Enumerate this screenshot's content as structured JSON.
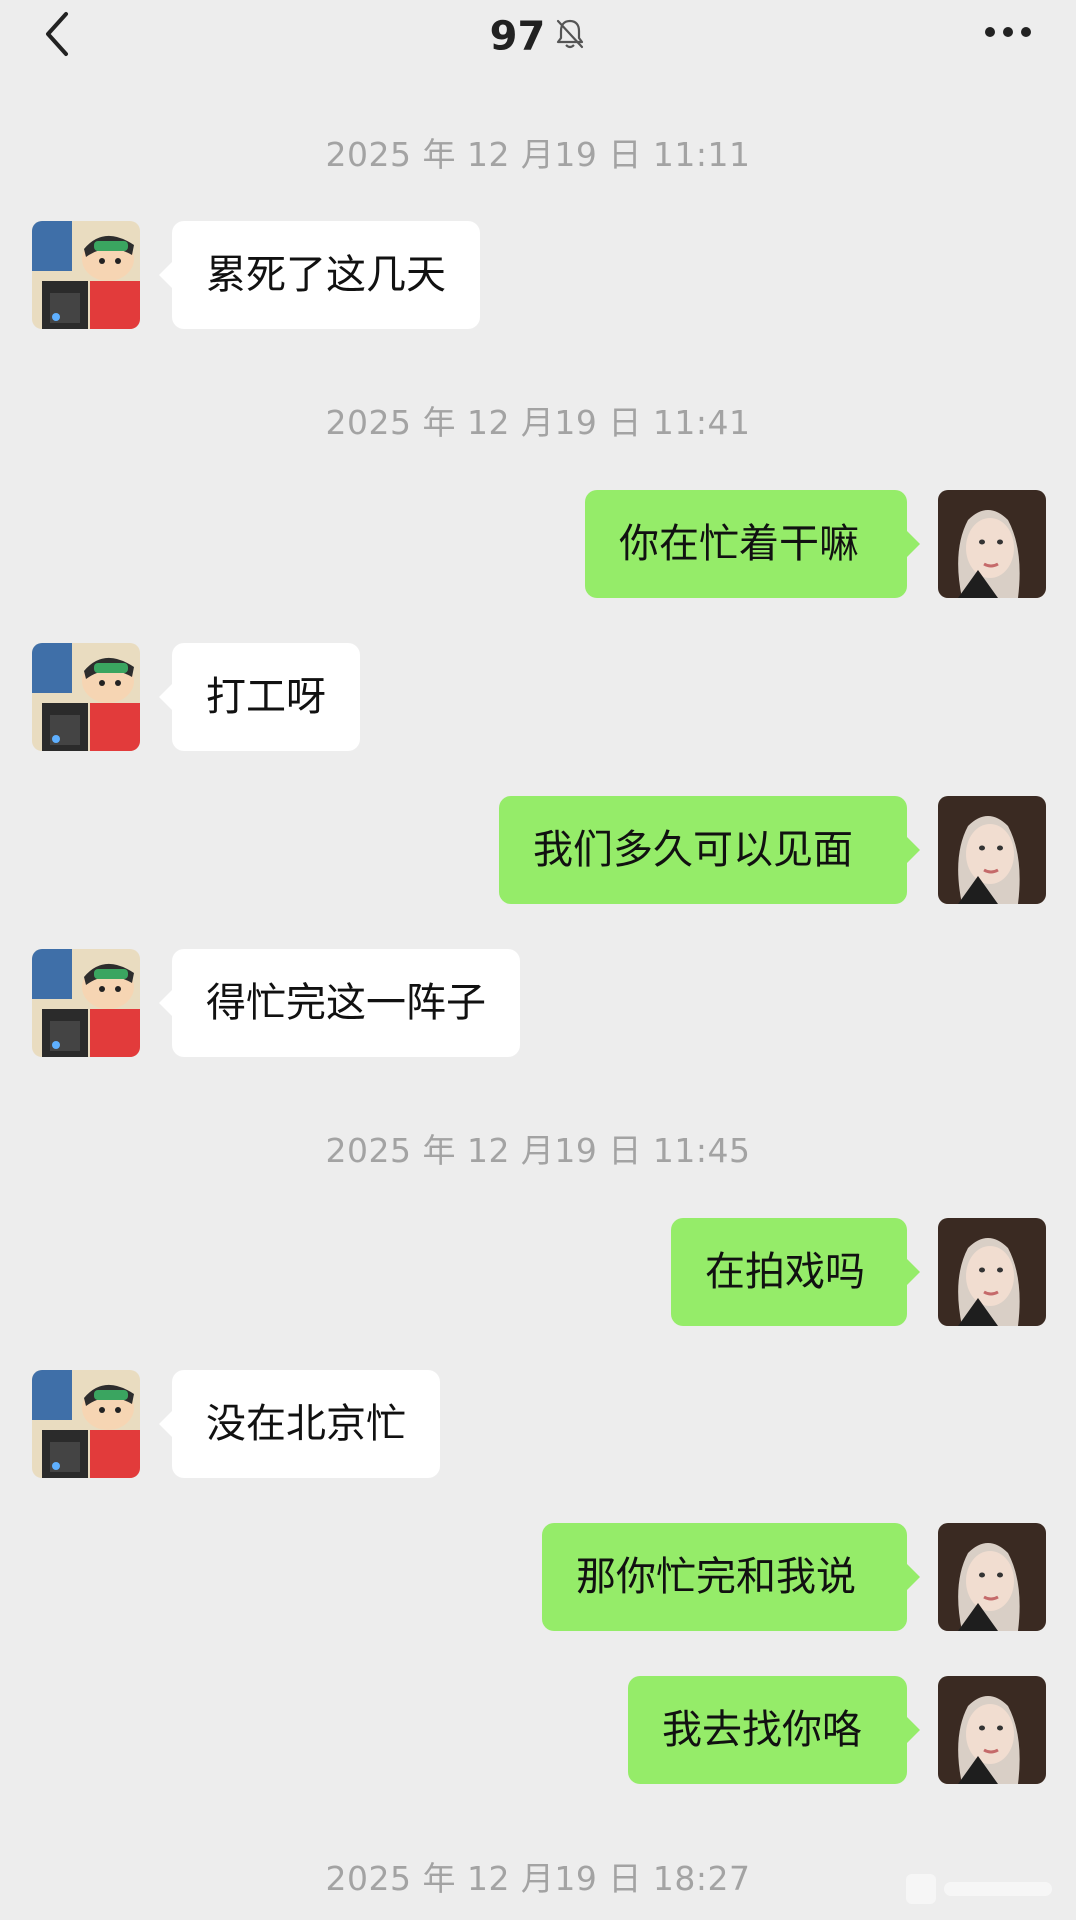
{
  "header": {
    "title": "97",
    "back_icon": "chevron-left-icon",
    "mute_icon": "bell-off-icon",
    "more_icon": "more-horizontal-icon"
  },
  "colors": {
    "background": "#ededed",
    "incoming_bubble": "#ffffff",
    "outgoing_bubble": "#95ec69",
    "timestamp_text": "#a3a3a3"
  },
  "messages": {
    "ts1": "2025 年 12 月19 日 11:11",
    "m1": "累死了这几天",
    "ts2": "2025 年 12 月19 日 11:41",
    "m2": "你在忙着干嘛",
    "m3": "打工呀",
    "m4": "我们多久可以见面",
    "m5": "得忙完这一阵子",
    "ts3": "2025 年 12 月19 日 11:45",
    "m6": "在拍戏吗",
    "m7": "没在北京忙",
    "m8": "那你忙完和我说",
    "m9": "我去找你咯",
    "ts4": "2025 年 12 月19 日 18:27"
  }
}
